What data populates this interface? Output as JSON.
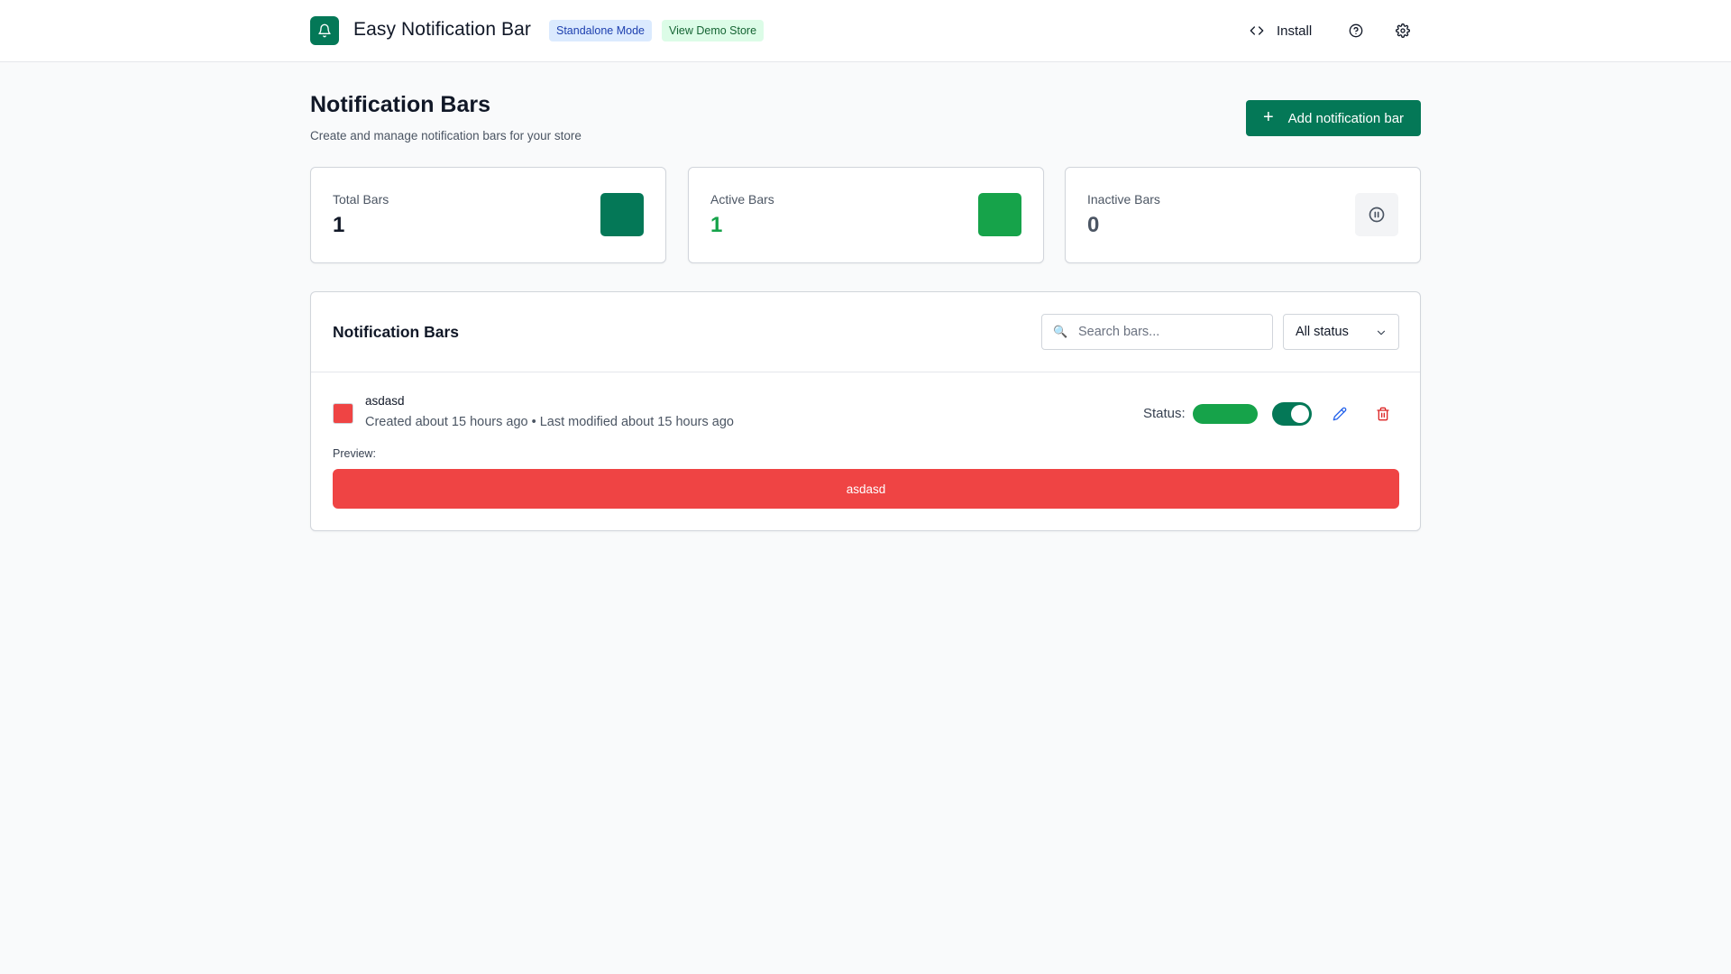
{
  "header": {
    "app_title": "Easy Notification Bar",
    "badge_mode": "Standalone Mode",
    "badge_demo": "View Demo Store",
    "install_label": "Install",
    "icons": [
      "bell-icon",
      "code-icon",
      "help-icon",
      "gear-icon"
    ]
  },
  "page": {
    "title": "Notification Bars",
    "subtitle": "Create and manage notification bars for your store",
    "add_button_label": "Add notification bar"
  },
  "stats": [
    {
      "label": "Total Bars",
      "value": "1",
      "color": "#047857"
    },
    {
      "label": "Active Bars",
      "value": "1",
      "color": "#16a34a"
    },
    {
      "label": "Inactive Bars",
      "value": "0",
      "color": "#f3f4f6"
    }
  ],
  "list": {
    "title": "Notification Bars",
    "search_placeholder": "Search bars...",
    "status_filter": "All status",
    "items": [
      {
        "name": "asdasd",
        "meta": "Created about 15 hours ago • Last modified about 15 hours ago",
        "status_label": "Status:",
        "enabled": true,
        "color": "#ef4444",
        "preview_label": "Preview:",
        "preview_text": "asdasd"
      }
    ]
  },
  "colors": {
    "brand": "#047857",
    "active": "#16a34a",
    "danger": "#dc2626",
    "bar_color": "#ef4444"
  }
}
